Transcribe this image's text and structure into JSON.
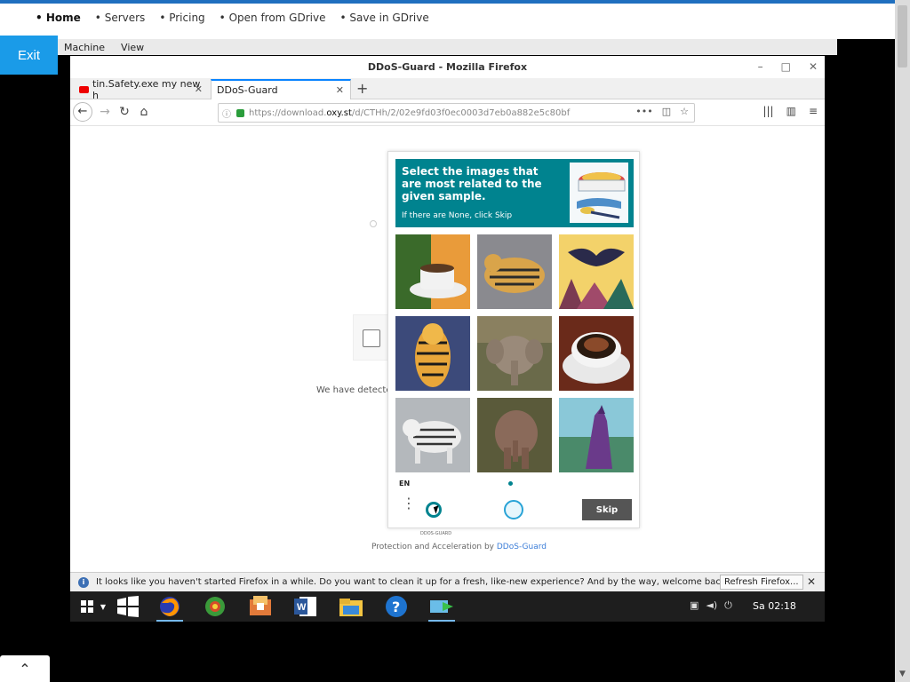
{
  "host_nav": {
    "items": [
      "Home",
      "Servers",
      "Pricing",
      "Open from GDrive",
      "Save in GDrive"
    ]
  },
  "exit_label": "Exit",
  "vm_menu": [
    "Machine",
    "View"
  ],
  "firefox": {
    "window_title": "DDoS-Guard - Mozilla Firefox",
    "tabs": [
      {
        "label": "tin.Safety.exe my new h"
      },
      {
        "label": "DDoS-Guard"
      }
    ],
    "url_prefix": "https://download.",
    "url_host": "oxy.st",
    "url_path": "/d/CTHh/2/02e9fd03f0ec0003d7eb0a882e5c80bf"
  },
  "page": {
    "detected_text": "We have detecte",
    "footer_prefix": "Protection and Acceleration by ",
    "footer_link": "DDoS-Guard"
  },
  "captcha": {
    "title": "Select the images that are most related to the given sample.",
    "subtitle": "If there are None, click Skip",
    "lang": "EN",
    "logo_label": "DDOS-GUARD",
    "skip_label": "Skip",
    "images": [
      "coffee-cup",
      "tiger",
      "bat",
      "tiger",
      "elephant",
      "coffee-cup",
      "white-tiger",
      "elephant",
      "wolf"
    ]
  },
  "notification": {
    "text": "It looks like you haven't started Firefox in a while. Do you want to clean it up for a fresh, like-new experience? And by the way, welcome back!",
    "button": "Refresh Firefox..."
  },
  "taskbar": {
    "time": "Sa 02:18"
  }
}
